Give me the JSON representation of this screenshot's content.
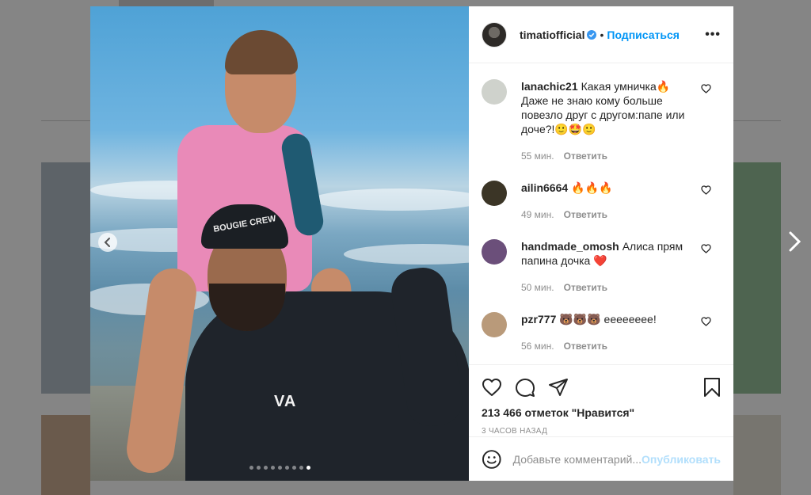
{
  "post": {
    "author": "timatiofficial",
    "separator": "•",
    "follow_label": "Подписаться",
    "more_label": "•••",
    "cap_text": "BOUGIE CREW",
    "shirt_logo": "VA",
    "carousel": {
      "count": 9,
      "active_index": 8
    }
  },
  "comments": [
    {
      "user": "lanachic21",
      "text": "Какая умничка🔥 Даже не знаю кому больше повезло друг с другом:папе или доче?!🙂🤩🙂",
      "time": "55 мин.",
      "reply": "Ответить",
      "avatar_color": "#cfd2cc"
    },
    {
      "user": "ailin6664",
      "text": "🔥🔥🔥",
      "time": "49 мин.",
      "reply": "Ответить",
      "avatar_color": "#3b3526"
    },
    {
      "user": "handmade_omosh",
      "text": "Алиса прям папина дочка ❤️",
      "time": "50 мин.",
      "reply": "Ответить",
      "avatar_color": "#6b4f7a"
    },
    {
      "user": "pzr777",
      "text": "🐻🐻🐻 eeeeeeee!",
      "time": "56 мин.",
      "reply": "Ответить",
      "avatar_color": "#b99a7a"
    }
  ],
  "likes_text": "213 466 отметок \"Нравится\"",
  "posted_time": "3 ЧАСОВ НАЗАД",
  "add_comment": {
    "placeholder": "Добавьте комментарий...",
    "publish_label": "Опубликовать"
  },
  "colors": {
    "link_blue": "#0095f6",
    "publish_disabled": "#b2dffc",
    "overlay": "#858585"
  },
  "icons": [
    "verified-badge-icon",
    "more-options-icon",
    "heart-icon",
    "comment-icon",
    "share-icon",
    "bookmark-icon",
    "emoji-icon",
    "chevron-left-icon",
    "chevron-right-icon"
  ]
}
